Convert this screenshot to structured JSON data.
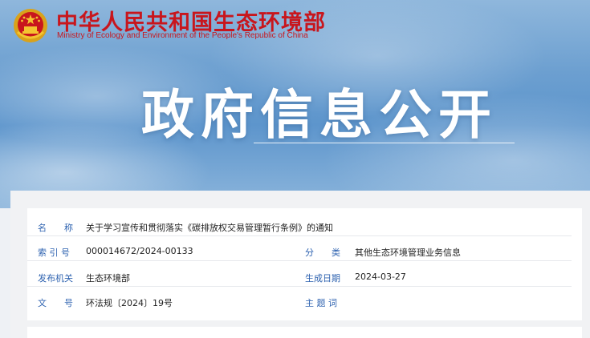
{
  "header": {
    "ministry_cn": "中华人民共和国生态环境部",
    "ministry_en": "Ministry of Ecology and Environment of the People's Republic of China",
    "emblem_icon": "national-emblem-icon",
    "page_title": "政府信息公开"
  },
  "info": {
    "name_label": "名　　称",
    "name_value": "关于学习宣传和贯彻落实《碳排放权交易管理暂行条例》的通知",
    "index_label": "索 引 号",
    "index_value": "000014672/2024-00133",
    "category_label": "分　　类",
    "category_value": "其他生态环境管理业务信息",
    "issuer_label": "发布机关",
    "issuer_value": "生态环境部",
    "date_label": "生成日期",
    "date_value": "2024-03-27",
    "docno_label": "文　　号",
    "docno_value": "环法规〔2024〕19号",
    "subject_label": "主 题 词",
    "subject_value": ""
  },
  "colors": {
    "brand_red": "#c8161d",
    "label_blue": "#2f63b0"
  }
}
